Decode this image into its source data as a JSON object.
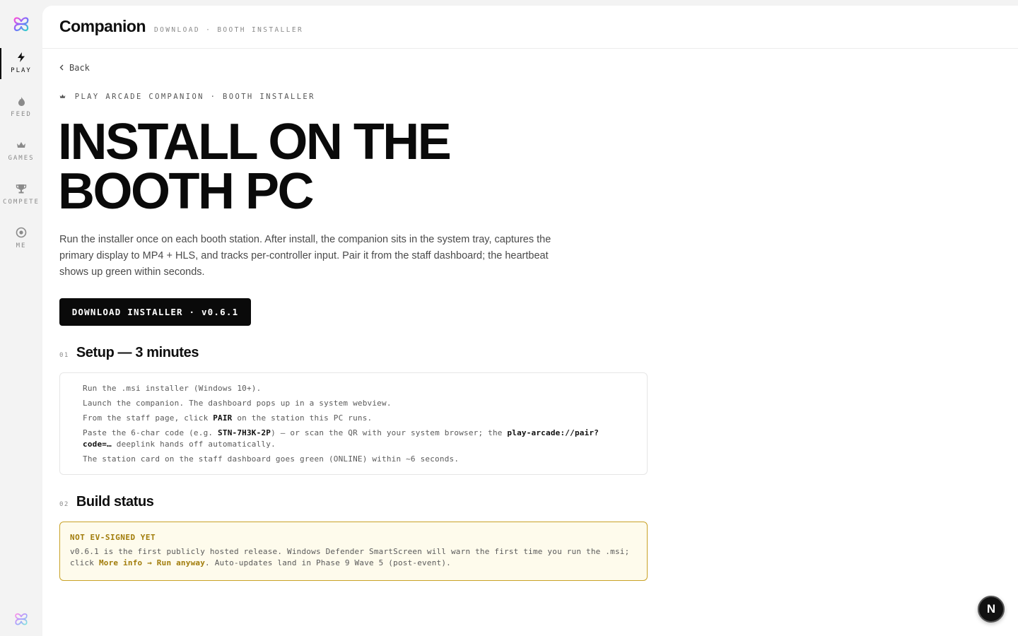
{
  "sidebar": {
    "items": [
      {
        "label": "PLAY",
        "icon": "lightning-icon",
        "active": true
      },
      {
        "label": "FEED",
        "icon": "flame-icon",
        "active": false
      },
      {
        "label": "GAMES",
        "icon": "crown-icon",
        "active": false
      },
      {
        "label": "COMPETE",
        "icon": "trophy-icon",
        "active": false
      },
      {
        "label": "ME",
        "icon": "target-icon",
        "active": false
      }
    ]
  },
  "header": {
    "title": "Companion",
    "breadcrumb": "DOWNLOAD · BOOTH INSTALLER"
  },
  "main": {
    "back_label": "Back",
    "eyebrow": "PLAY ARCADE COMPANION · BOOTH INSTALLER",
    "hero_line1": "INSTALL ON THE",
    "hero_line2": "BOOTH PC",
    "lede": "Run the installer once on each booth station. After install, the companion sits in the system tray, captures the primary display to MP4 + HLS, and tracks per-controller input. Pair it from the staff dashboard; the heartbeat shows up green within seconds.",
    "download_label": "DOWNLOAD INSTALLER · v0.6.1",
    "setup": {
      "num": "01",
      "title": "Setup — 3 minutes",
      "step1": "Run the .msi installer (Windows 10+).",
      "step2": "Launch the companion. The dashboard pops up in a system webview.",
      "step3_a": "From the staff page, click ",
      "step3_b": "PAIR",
      "step3_c": " on the station this PC runs.",
      "step4_a": "Paste the 6-char code (e.g. ",
      "step4_b": "STN-7H3K-2P",
      "step4_c": ") — or scan the QR with your system browser; the ",
      "step4_d": "play-arcade://pair?code=…",
      "step4_e": " deeplink hands off automatically.",
      "step5": "The station card on the staff dashboard goes green (ONLINE) within ~6 seconds."
    },
    "build": {
      "num": "02",
      "title": "Build status",
      "notice_title": "NOT EV-SIGNED YET",
      "body_a": "v0.6.1 is the first publicly hosted release. Windows Defender SmartScreen will warn the first time you run the .msi; click ",
      "body_b": "More info → Run anyway",
      "body_c": ". Auto-updates land in Phase 9 Wave 5 (post-event)."
    }
  },
  "badge": "N",
  "colors": {
    "accent": "#0a0a0a",
    "warning_border": "#c9a227",
    "warning_bg": "#fefbec",
    "warning_text": "#a17c0a"
  }
}
